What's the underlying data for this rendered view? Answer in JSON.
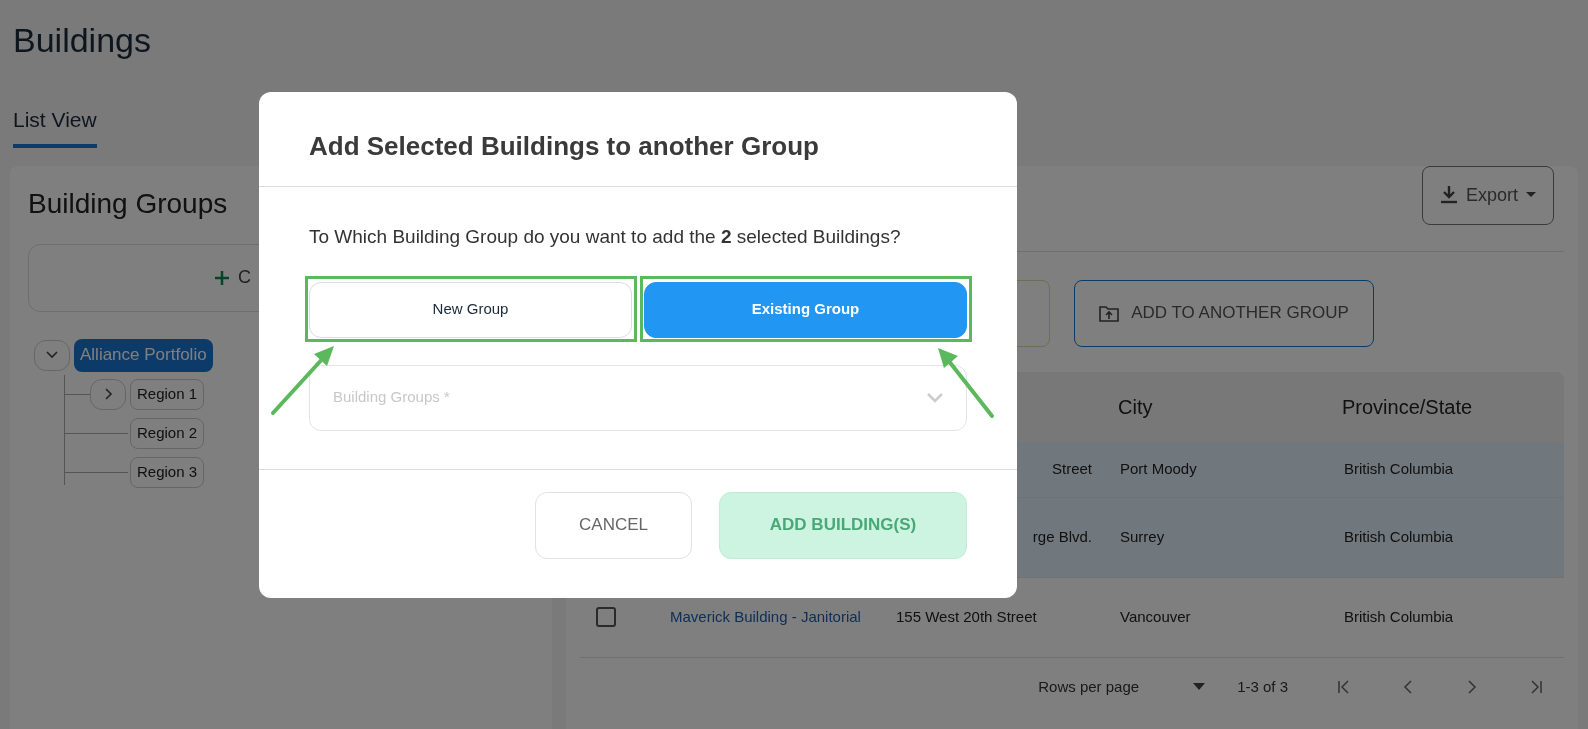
{
  "page": {
    "title": "Buildings",
    "tabs": [
      {
        "label": "List View",
        "selected": true
      }
    ]
  },
  "sidebar": {
    "title": "Building Groups",
    "create_button": "C",
    "tree": [
      {
        "label": "Alliance Portfolio",
        "kind": "branch",
        "expanded": true,
        "selected": true,
        "children": [
          {
            "label": "Region 1",
            "kind": "branch",
            "expanded": false,
            "selected": false
          },
          {
            "label": "Region 2",
            "kind": "leaf",
            "selected": false
          },
          {
            "label": "Region 3",
            "kind": "leaf",
            "selected": false
          }
        ]
      }
    ]
  },
  "toolbar": {
    "export_button": "Export",
    "add_button": "ADD TO ANOTHER GROUP"
  },
  "table": {
    "columns": [
      {
        "label": "City"
      },
      {
        "label": "Province/State"
      }
    ],
    "rows": [
      {
        "selected": true,
        "address": "Street",
        "city": "Port Moody",
        "province": "British Columbia"
      },
      {
        "selected": true,
        "address": "rge Blvd.",
        "city": "Surrey",
        "province": "British Columbia"
      },
      {
        "selected": false,
        "name": "Maverick Building - Janitorial",
        "address": "155 West 20th Street",
        "city": "Vancouver",
        "province": "British Columbia"
      }
    ]
  },
  "pagination": {
    "rows_per_page_label": "Rows per page",
    "range": "1-3 of 3"
  },
  "modal": {
    "title": "Add Selected Buildings to another Group",
    "question": "To Which Building Group do you want to add the **2** selected Buildings?",
    "options": [
      {
        "label": "New Group",
        "selected": false
      },
      {
        "label": "Existing Group",
        "selected": true
      }
    ],
    "select": {
      "placeholder": "Building Groups *"
    },
    "cancel_button": "CANCEL",
    "submit_button": {
      "label": "ADD BUILDING(S)",
      "disabled": true
    }
  }
}
